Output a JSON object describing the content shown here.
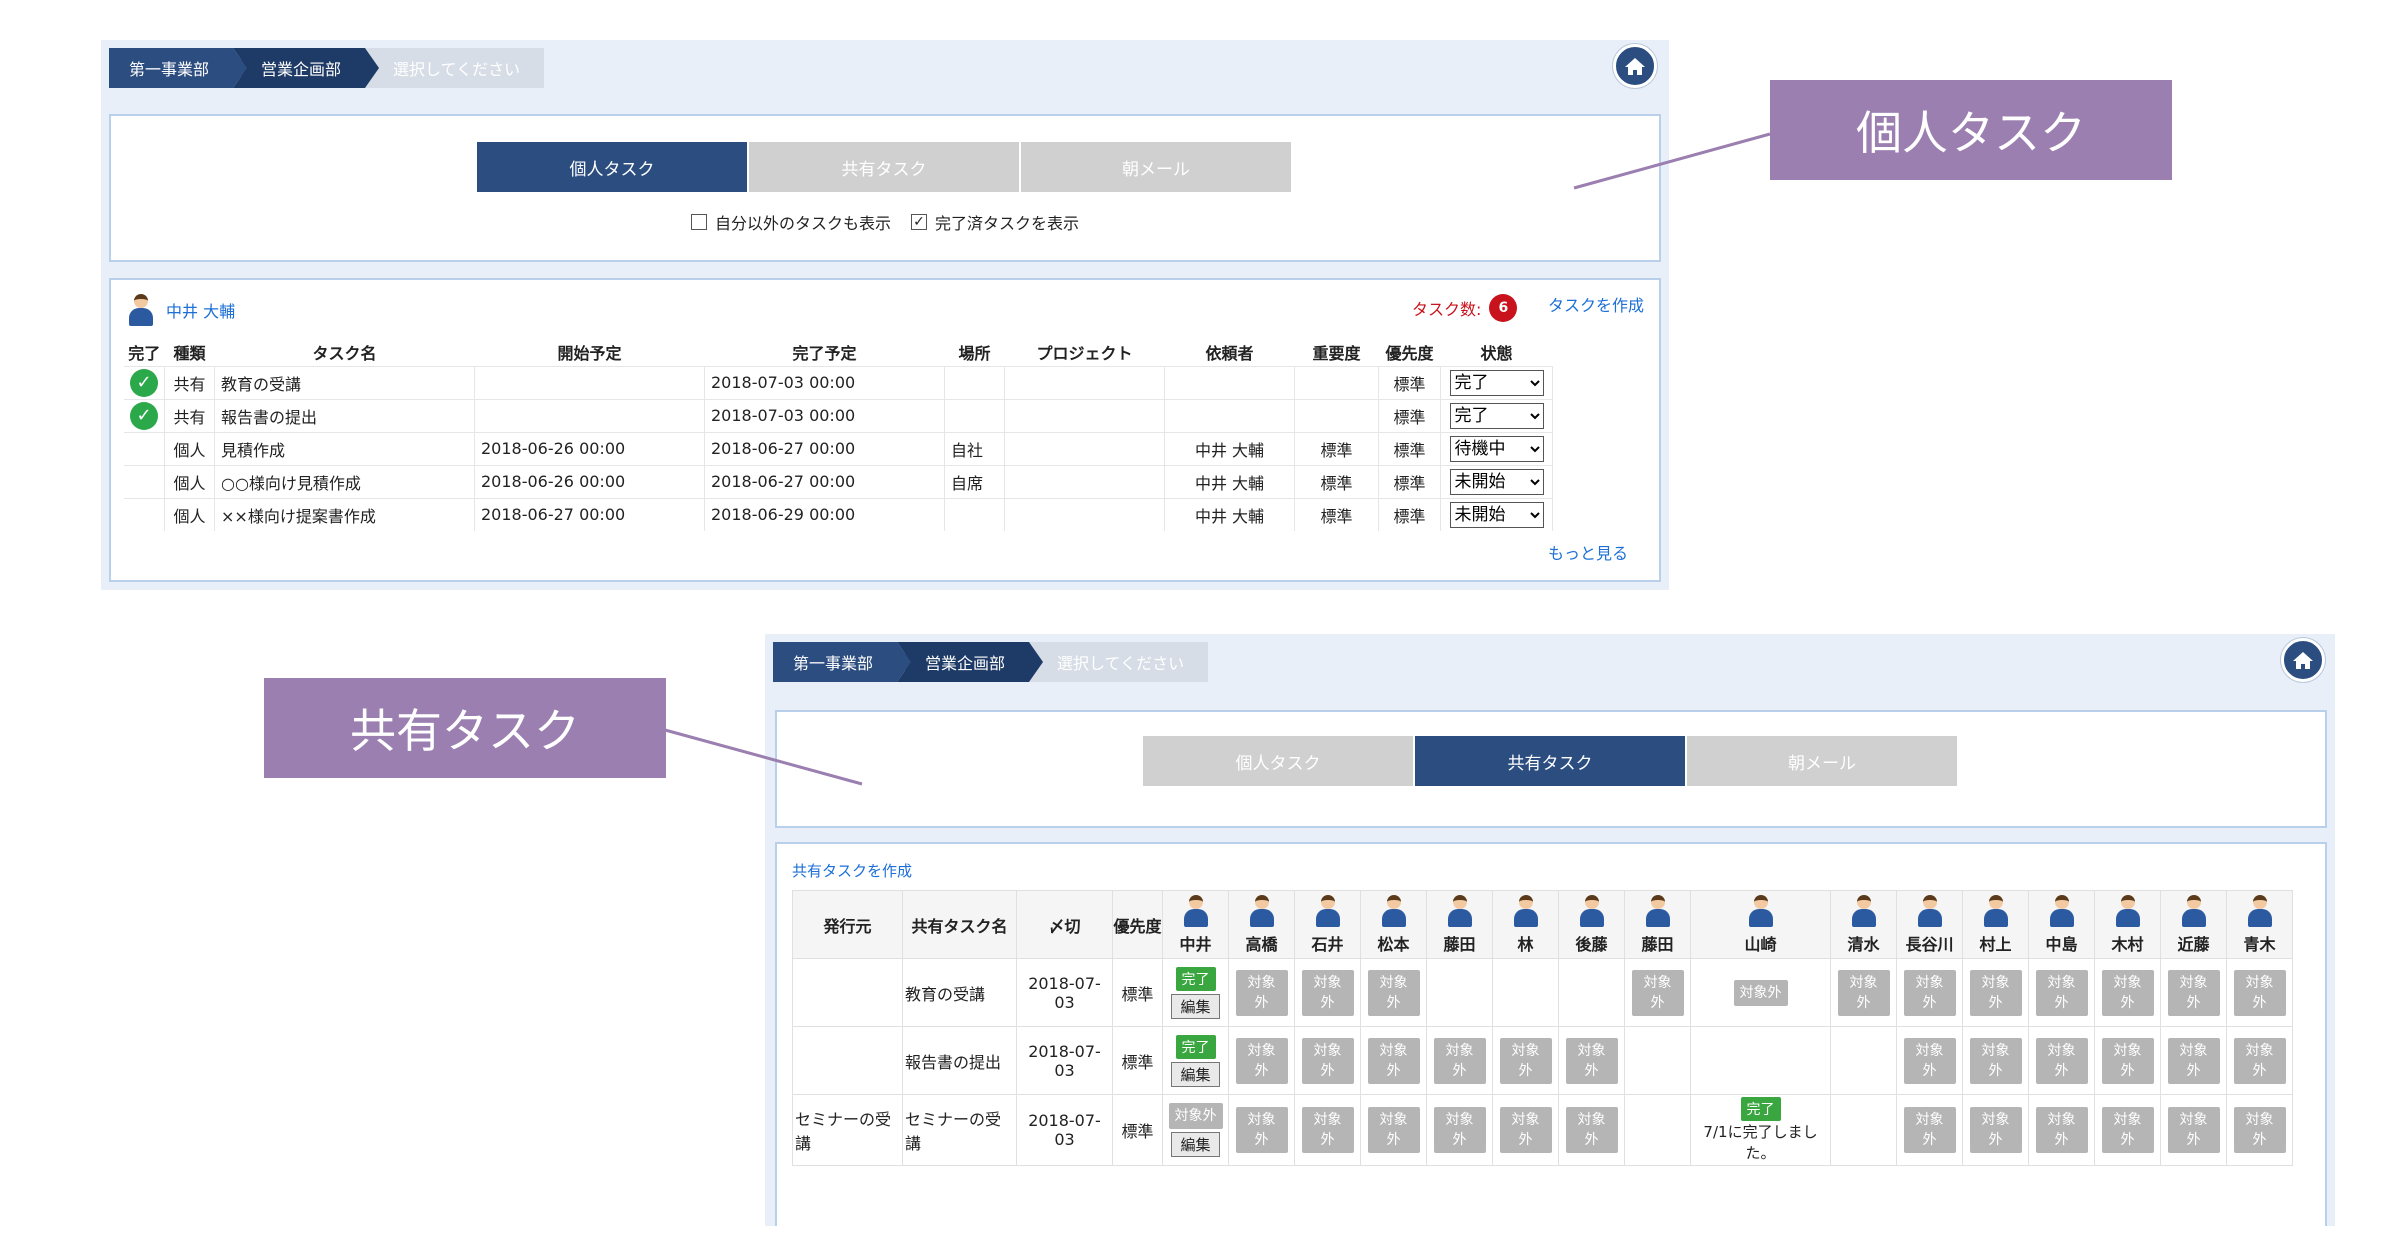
{
  "breadcrumb": [
    "第一事業部",
    "営業企画部",
    "選択してください"
  ],
  "tabs": [
    "個人タスク",
    "共有タスク",
    "朝メール"
  ],
  "checkbox1": {
    "label": "自分以外のタスクも表示",
    "checked": false
  },
  "checkbox2": {
    "label": "完了済タスクを表示",
    "checked": true
  },
  "personal": {
    "user": "中井 大輔",
    "task_count_label": "タスク数:",
    "task_count": "6",
    "create_link": "タスクを作成",
    "more_link": "もっと見る",
    "headers": [
      "完了",
      "種類",
      "タスク名",
      "開始予定",
      "完了予定",
      "場所",
      "プロジェクト",
      "依頼者",
      "重要度",
      "優先度",
      "状態"
    ],
    "rows": [
      {
        "done": true,
        "type": "共有",
        "name": "教育の受講",
        "start": "",
        "end": "2018-07-03 00:00",
        "place": "",
        "project": "",
        "requester": "",
        "importance": "",
        "priority": "標準",
        "status": "完了"
      },
      {
        "done": true,
        "type": "共有",
        "name": "報告書の提出",
        "start": "",
        "end": "2018-07-03 00:00",
        "place": "",
        "project": "",
        "requester": "",
        "importance": "",
        "priority": "標準",
        "status": "完了"
      },
      {
        "done": false,
        "type": "個人",
        "name": "見積作成",
        "start": "2018-06-26 00:00",
        "end": "2018-06-27 00:00",
        "place": "自社",
        "project": "",
        "requester": "中井 大輔",
        "importance": "標準",
        "priority": "標準",
        "status": "待機中"
      },
      {
        "done": false,
        "type": "個人",
        "name": "○○様向け見積作成",
        "start": "2018-06-26 00:00",
        "end": "2018-06-27 00:00",
        "place": "自席",
        "project": "",
        "requester": "中井 大輔",
        "importance": "標準",
        "priority": "標準",
        "status": "未開始"
      },
      {
        "done": false,
        "type": "個人",
        "name": "××様向け提案書作成",
        "start": "2018-06-27 00:00",
        "end": "2018-06-29 00:00",
        "place": "",
        "project": "",
        "requester": "中井 大輔",
        "importance": "標準",
        "priority": "標準",
        "status": "未開始"
      }
    ]
  },
  "shared": {
    "create_link": "共有タスクを作成",
    "headers": [
      "発行元",
      "共有タスク名",
      "〆切",
      "優先度"
    ],
    "members": [
      "中井",
      "高橋",
      "石井",
      "松本",
      "藤田",
      "林",
      "後藤",
      "藤田",
      "山崎",
      "清水",
      "長谷川",
      "村上",
      "中島",
      "木村",
      "近藤",
      "青木"
    ],
    "labels": {
      "out": "対象外",
      "done": "完了",
      "edit": "編集"
    },
    "rows": [
      {
        "issuer": "",
        "name": "教育の受講",
        "deadline": "2018-07-03",
        "priority": "標準",
        "cells": [
          "done-edit",
          "out",
          "out",
          "out",
          "",
          "",
          "",
          "out",
          "out-wide",
          "out",
          "out",
          "out",
          "out",
          "out",
          "out",
          "out"
        ]
      },
      {
        "issuer": "",
        "name": "報告書の提出",
        "deadline": "2018-07-03",
        "priority": "標準",
        "cells": [
          "done-edit",
          "out",
          "out",
          "out",
          "out",
          "out",
          "out",
          "",
          "",
          "",
          "out",
          "out",
          "out",
          "out",
          "out",
          "out"
        ]
      },
      {
        "issuer": "セミナーの受講",
        "name": "セミナーの受講",
        "deadline": "2018-07-03",
        "priority": "標準",
        "cells": [
          "out-edit",
          "out",
          "out",
          "out",
          "out",
          "out",
          "out",
          "",
          "done-note",
          "",
          "out",
          "out",
          "out",
          "out",
          "out",
          "out"
        ]
      }
    ],
    "done_note": "7/1に完了しました。"
  },
  "callouts": {
    "personal": "個人タスク",
    "shared": "共有タスク"
  },
  "colors": {
    "accent": "#2c4d80",
    "callout": "#9b7fb0",
    "done": "#3aa63f",
    "badge": "#c8131c",
    "link": "#1c6fd6"
  }
}
